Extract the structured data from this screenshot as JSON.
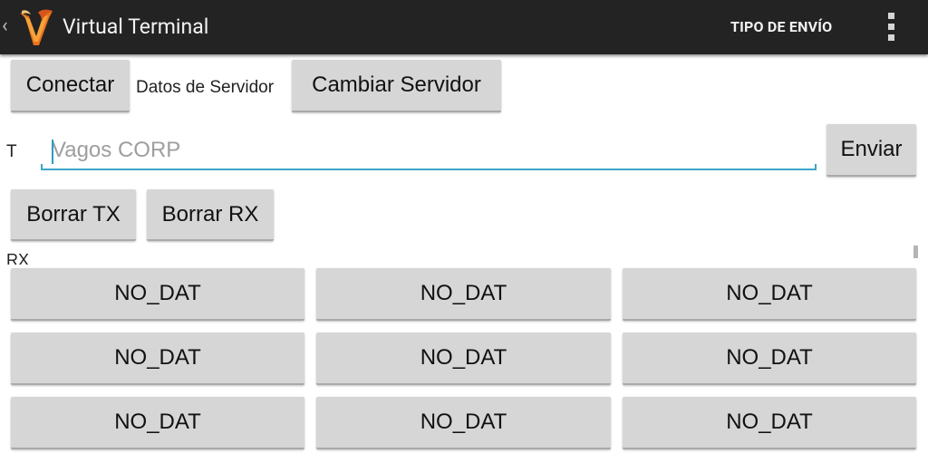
{
  "actionbar": {
    "title": "Virtual Terminal",
    "send_type": "TIPO DE ENVÍO",
    "logo_icon": "vagos-v-flame-logo",
    "overflow_icon": "overflow-menu-icon",
    "up_icon": "up-caret-icon",
    "background": "#232323"
  },
  "toolbar": {
    "connect": "Conectar",
    "server_data": "Datos de Servidor",
    "change_server": "Cambiar Servidor"
  },
  "tx": {
    "label": "T",
    "placeholder": "Vagos CORP",
    "value": "",
    "send": "Enviar"
  },
  "clear": {
    "tx": "Borrar TX",
    "rx": "Borrar RX"
  },
  "rx": {
    "label": "RX"
  },
  "grid": [
    [
      "NO_DAT",
      "NO_DAT",
      "NO_DAT"
    ],
    [
      "NO_DAT",
      "NO_DAT",
      "NO_DAT"
    ],
    [
      "NO_DAT",
      "NO_DAT",
      "NO_DAT"
    ]
  ],
  "colors": {
    "accent": "#3da6c8",
    "button": "#d6d6d6"
  }
}
